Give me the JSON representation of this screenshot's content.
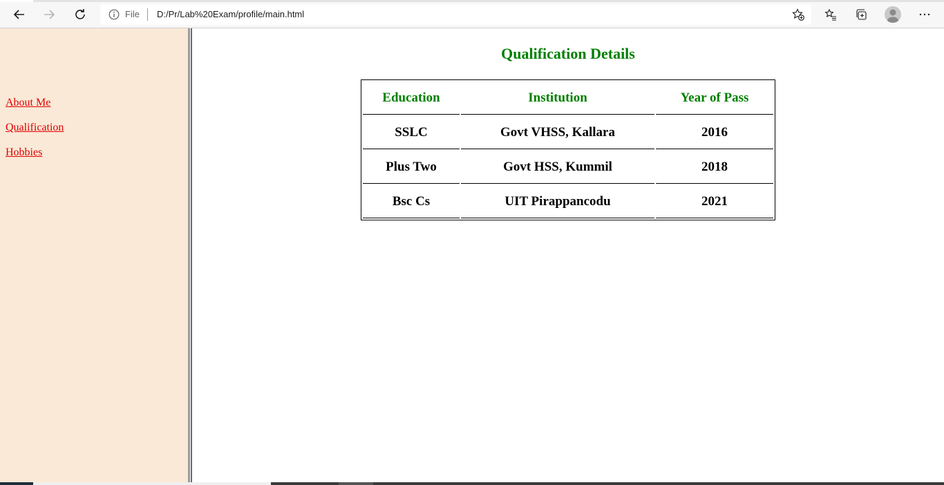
{
  "browser": {
    "address": {
      "scheme_label": "File",
      "url": "D:/Pr/Lab%20Exam/profile/main.html"
    },
    "icons": {
      "back": "back-arrow-icon",
      "forward": "forward-arrow-icon",
      "refresh": "refresh-icon",
      "info": "info-icon",
      "add_favorite": "star-plus-icon",
      "favorites": "favorites-list-icon",
      "collections": "collections-icon",
      "profile": "profile-avatar-icon",
      "more": "more-dots-icon"
    }
  },
  "sidebar": {
    "links": [
      {
        "label": "About Me"
      },
      {
        "label": "Qualification"
      },
      {
        "label": "Hobbies"
      }
    ],
    "link_color": "#e00000",
    "background": "#fae9d7"
  },
  "main": {
    "title": "Qualification Details",
    "title_color": "#008000",
    "table": {
      "headers": [
        "Education",
        "Institution",
        "Year of Pass"
      ],
      "rows": [
        [
          "SSLC",
          "Govt VHSS, Kallara",
          "2016"
        ],
        [
          "Plus Two",
          "Govt HSS, Kummil",
          "2018"
        ],
        [
          "Bsc Cs",
          "UIT Pirappancodu",
          "2021"
        ]
      ]
    }
  }
}
